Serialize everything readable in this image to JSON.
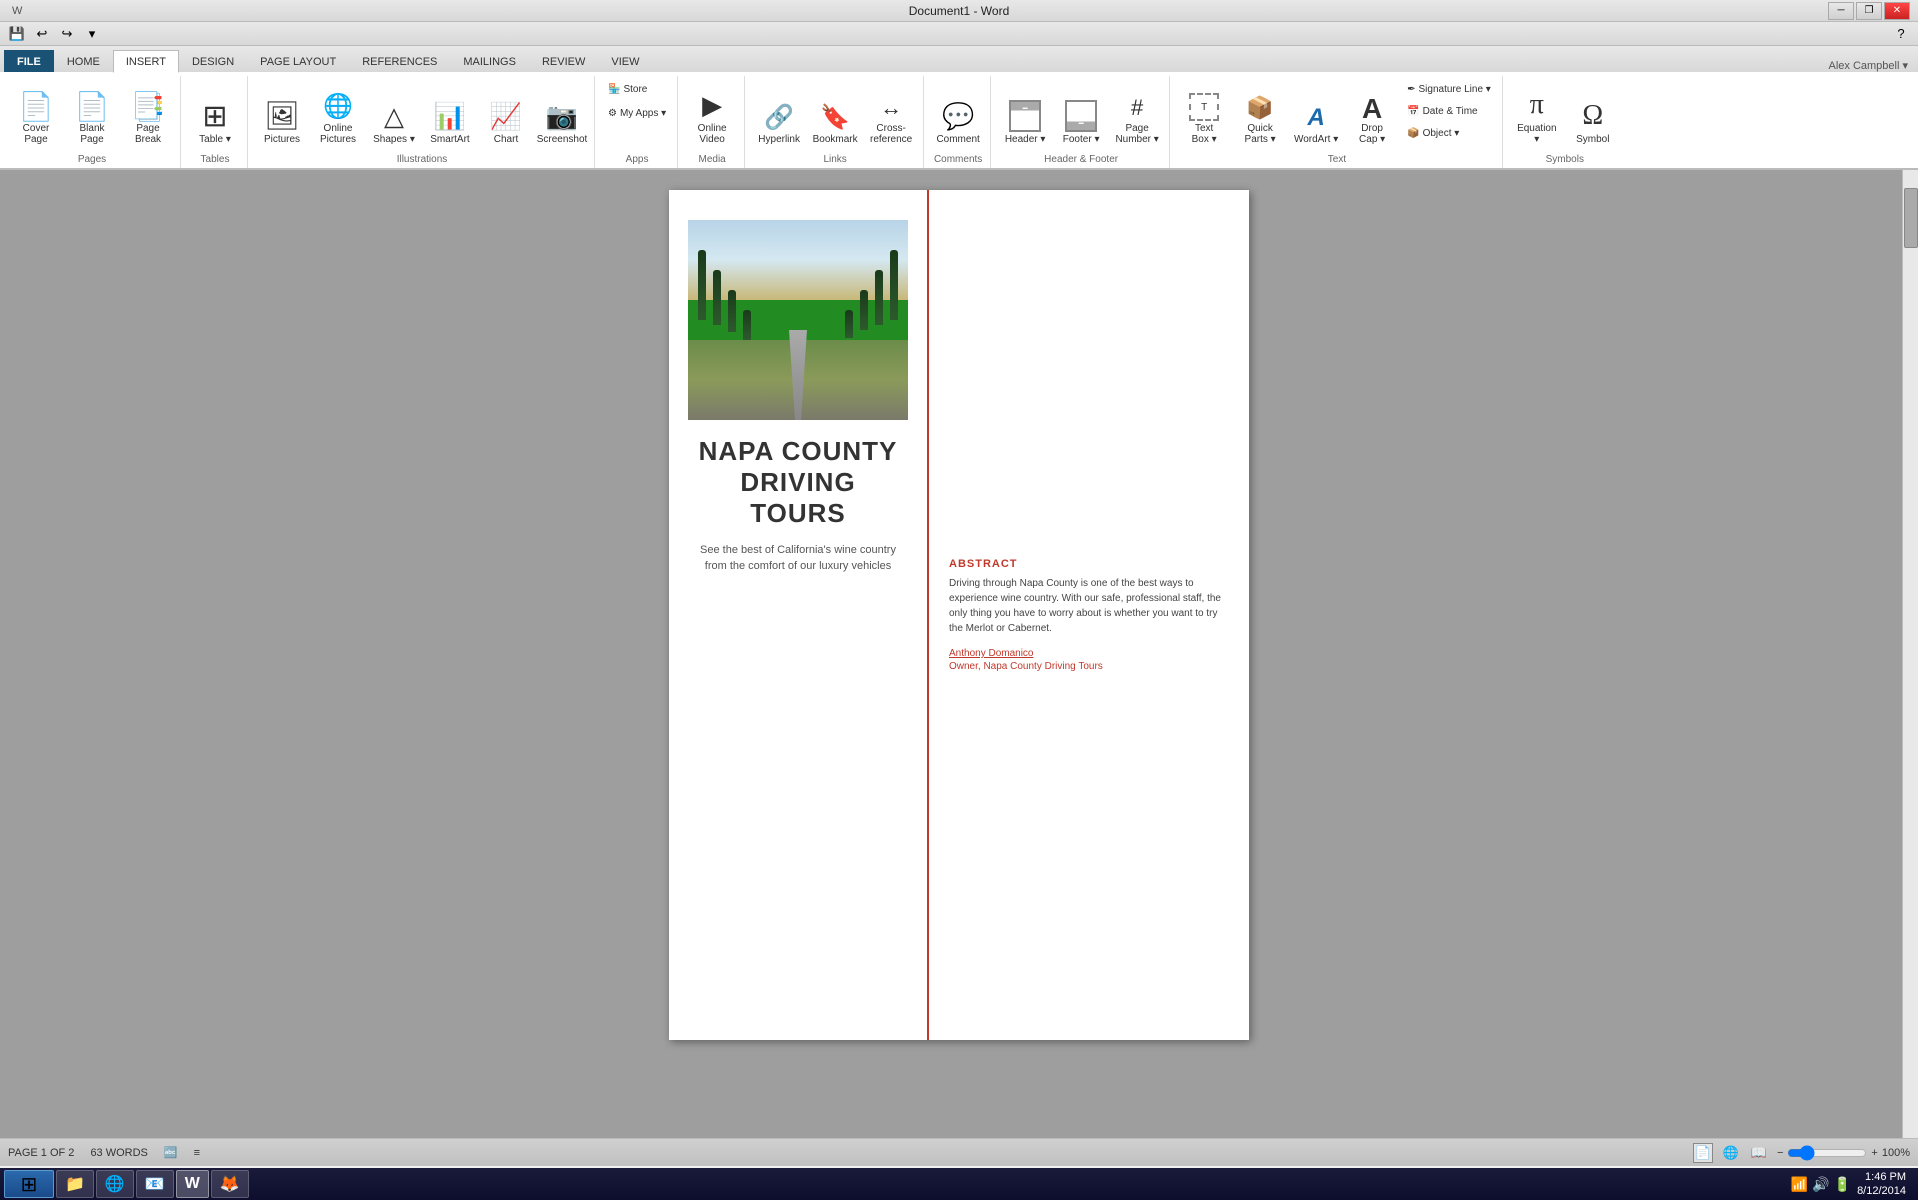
{
  "titlebar": {
    "title": "Document1 - Word",
    "minimize": "─",
    "restore": "❐",
    "close": "✕"
  },
  "qat": {
    "save": "💾",
    "undo": "↩",
    "redo": "↪",
    "customize": "▾"
  },
  "tabs": [
    {
      "id": "file",
      "label": "FILE"
    },
    {
      "id": "home",
      "label": "HOME"
    },
    {
      "id": "insert",
      "label": "INSERT",
      "active": true
    },
    {
      "id": "design",
      "label": "DESIGN"
    },
    {
      "id": "page-layout",
      "label": "PAGE LAYOUT"
    },
    {
      "id": "references",
      "label": "REFERENCES"
    },
    {
      "id": "mailings",
      "label": "MAILINGS"
    },
    {
      "id": "review",
      "label": "REVIEW"
    },
    {
      "id": "view",
      "label": "VIEW"
    }
  ],
  "ribbon": {
    "groups": [
      {
        "id": "pages",
        "label": "Pages",
        "buttons": [
          {
            "id": "cover-page",
            "label": "Cover\nPage",
            "icon": "📄"
          },
          {
            "id": "blank-page",
            "label": "Blank\nPage",
            "icon": "📄"
          },
          {
            "id": "page-break",
            "label": "Page\nBreak",
            "icon": "📑"
          }
        ]
      },
      {
        "id": "tables",
        "label": "Tables",
        "buttons": [
          {
            "id": "table",
            "label": "Table",
            "icon": "⊞"
          }
        ]
      },
      {
        "id": "illustrations",
        "label": "Illustrations",
        "buttons": [
          {
            "id": "pictures",
            "label": "Pictures",
            "icon": "🖼"
          },
          {
            "id": "online-pictures",
            "label": "Online\nPictures",
            "icon": "🌐"
          },
          {
            "id": "shapes",
            "label": "Shapes",
            "icon": "△"
          },
          {
            "id": "smartart",
            "label": "SmartArt",
            "icon": "📊"
          },
          {
            "id": "chart",
            "label": "Chart",
            "icon": "📈"
          },
          {
            "id": "screenshot",
            "label": "Screenshot",
            "icon": "📷"
          }
        ]
      },
      {
        "id": "apps",
        "label": "Apps",
        "buttons": [
          {
            "id": "store",
            "label": "Store",
            "icon": "🏪"
          },
          {
            "id": "my-apps",
            "label": "My Apps",
            "icon": "⚙"
          }
        ]
      },
      {
        "id": "media",
        "label": "Media",
        "buttons": [
          {
            "id": "online-video",
            "label": "Online\nVideo",
            "icon": "▶"
          }
        ]
      },
      {
        "id": "links",
        "label": "Links",
        "buttons": [
          {
            "id": "hyperlink",
            "label": "Hyperlink",
            "icon": "🔗"
          },
          {
            "id": "bookmark",
            "label": "Bookmark",
            "icon": "🔖"
          },
          {
            "id": "cross-reference",
            "label": "Cross-\nreference",
            "icon": "↔"
          }
        ]
      },
      {
        "id": "comments",
        "label": "Comments",
        "buttons": [
          {
            "id": "comment",
            "label": "Comment",
            "icon": "💬"
          }
        ]
      },
      {
        "id": "header-footer",
        "label": "Header & Footer",
        "buttons": [
          {
            "id": "header",
            "label": "Header",
            "icon": "⬜"
          },
          {
            "id": "footer",
            "label": "Footer",
            "icon": "⬜"
          },
          {
            "id": "page-number",
            "label": "Page\nNumber",
            "icon": "#"
          }
        ]
      },
      {
        "id": "text",
        "label": "Text",
        "buttons": [
          {
            "id": "text-box",
            "label": "Text\nBox",
            "icon": "⬜"
          },
          {
            "id": "quick-parts",
            "label": "Quick\nParts",
            "icon": "📦"
          },
          {
            "id": "wordart",
            "label": "WordArt",
            "icon": "A"
          },
          {
            "id": "drop-cap",
            "label": "Drop\nCap",
            "icon": "A"
          },
          {
            "id": "signature-line",
            "label": "Signature Line",
            "icon": "✒"
          },
          {
            "id": "date-time",
            "label": "Date & Time",
            "icon": "📅"
          },
          {
            "id": "object",
            "label": "Object",
            "icon": "📦"
          }
        ]
      },
      {
        "id": "symbols",
        "label": "Symbols",
        "buttons": [
          {
            "id": "equation",
            "label": "Equation",
            "icon": "π"
          },
          {
            "id": "symbol",
            "label": "Symbol",
            "icon": "Ω"
          }
        ]
      }
    ]
  },
  "document": {
    "cover_image_alt": "Cypress tree lined road in Tuscany/Napa",
    "title_line1": "NAPA COUNTY",
    "title_line2": "DRIVING TOURS",
    "subtitle": "See the best of California's wine country from the\ncomfort of our luxury vehicles",
    "abstract_label": "ABSTRACT",
    "abstract_text": "Driving through Napa County is one of the best ways to experience wine country. With our safe, professional staff, the only thing you have to worry about is whether you want to try the Merlot or Cabernet.",
    "author_name": "Anthony Domanico",
    "author_title": "Owner, Napa County Driving Tours"
  },
  "statusbar": {
    "page": "PAGE 1 OF 2",
    "words": "63 WORDS",
    "proofing_icon": "🔤",
    "view_print": "📄",
    "view_web": "🌐",
    "view_read": "📖",
    "zoom_out": "−",
    "zoom_in": "+",
    "zoom_level": "100%"
  },
  "taskbar": {
    "start_icon": "⊞",
    "apps": [
      {
        "id": "file-explorer",
        "icon": "📁"
      },
      {
        "id": "chrome",
        "icon": "🌐"
      },
      {
        "id": "outlook",
        "icon": "📧"
      },
      {
        "id": "word",
        "icon": "W",
        "active": true
      },
      {
        "id": "app5",
        "icon": "🦊"
      }
    ],
    "time": "1:46 PM",
    "date": "8/12/2014"
  }
}
